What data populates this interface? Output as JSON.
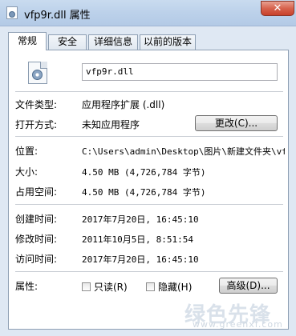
{
  "window": {
    "title": "vfp9r.dll 属性",
    "close_glyph": "✕"
  },
  "tabs": [
    "常规",
    "安全",
    "详细信息",
    "以前的版本"
  ],
  "general": {
    "filename": "vfp9r.dll",
    "file_type_label": "文件类型:",
    "file_type_value": "应用程序扩展 (.dll)",
    "opens_with_label": "打开方式:",
    "opens_with_value": "未知应用程序",
    "change_button": "更改(C)...",
    "location_label": "位置:",
    "location_value": "C:\\Users\\admin\\Desktop\\图片\\新建文件夹\\vf",
    "size_label": "大小:",
    "size_value": "4.50 MB (4,726,784 字节)",
    "size_on_disk_label": "占用空间:",
    "size_on_disk_value": "4.50 MB (4,726,784 字节)",
    "created_label": "创建时间:",
    "created_value": "2017年7月20日, 16:45:10",
    "modified_label": "修改时间:",
    "modified_value": "2011年10月5日, 8:51:54",
    "accessed_label": "访问时间:",
    "accessed_value": "2017年7月20日, 16:45:10",
    "attributes_label": "属性:",
    "readonly_label": "只读(R)",
    "hidden_label": "隐藏(H)",
    "advanced_button": "高级(D)..."
  },
  "watermark": {
    "text": "绿色先锋",
    "url": "www.greenxf.com"
  },
  "icons": {
    "title": "dll-file-icon",
    "file": "dll-file-icon"
  }
}
